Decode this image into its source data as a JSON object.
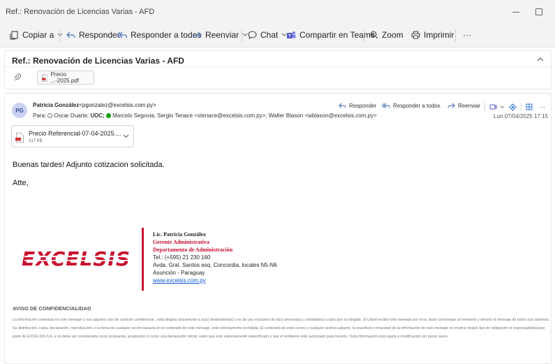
{
  "window": {
    "title": "Ref.: Renovación de Licencias Varias - AFD"
  },
  "toolbar": {
    "copy_label": "Copiar a",
    "reply_label": "Responder",
    "reply_all_label": "Responder a todos",
    "forward_label": "Reenviar",
    "chat_label": "Chat",
    "teams_label": "Compartir en Teams",
    "zoom_label": "Zoom",
    "print_label": "Imprimir",
    "more_label": "···"
  },
  "subject": {
    "text": "Ref.: Renovación de Licencias Varias - AFD",
    "attachment_chip": "Precio ...-2025.pdf"
  },
  "message": {
    "avatar_initials": "PG",
    "sender_name": "Patricia González",
    "sender_email": "<pgonzalez@excelsis.com.py>",
    "to_label": "Para:",
    "recipients": {
      "r1": "Oscar Duarte;",
      "r2": "UOC;",
      "r3": "Marcelo Segovia;",
      "r4": "Sergio Tenace <stenace@excelsis.com.py>;",
      "r5": "Walter Blason <wblason@excelsis.com.py>"
    },
    "actions": {
      "reply": "Responder",
      "reply_all": "Responder a todos",
      "forward": "Reenviar",
      "more": "···"
    },
    "date": "Lun 07/04/2025 17:15",
    "attachment": {
      "name": "Precio Referencial-07-04-2025....",
      "size": "217 KB"
    },
    "body_line1": "Buenas tardes! Adjunto cotizacion solicitada.",
    "body_line2": "Atte,"
  },
  "signature": {
    "logo_text": "EXCELSIS",
    "name": "Lic. Patricia González",
    "role1": "Gerente Administrativa",
    "role2": "Departamento de Administración",
    "phone": "Tel.: (+595) 21 230 160",
    "address": "Avda. Gral. Santos esq. Concordia, locales N5-N6",
    "city": "Asunción - Paraguay",
    "web": "www.excelsis.com.py"
  },
  "confidentiality": {
    "title": "AVISO DE CONFIDENCIALIDAD",
    "text": "La información contenida en este mensaje y sus adjuntos son de carácter confidencial , está dirigida únicamente a su(s) destinatario(s) y es de uso exclusivo de la(s) persona(s) y entidad(es) a la(s) que va dirigido. Si Usted recibió este mensaje por error, favor comunique al remitente y elimine el mensaje de todos sus sistemas. Su distribución, copia, declaración, reproducción, o la toma de cualquier acción basada en el contenido de este mensaje, está estrictamente prohibida. El contenido de este correo y cualquier archivo adjunto, la exactitud y veracidad de la información de este mensaje no implica ningún tipo de obligación ni responsabilidad por parte de EXCELSIS S.A. y no debe ser considerada como propuesta, aceptación ni como una declaración oficial, salvo que este expresamente especificado y que el remitente esté autorizado para hacerlo. Toda información está sujeta a modificación sin previo aviso."
  },
  "colors": {
    "brand_red": "#c8102e",
    "link_blue": "#0b57d0",
    "presence_green": "#13a10e"
  }
}
